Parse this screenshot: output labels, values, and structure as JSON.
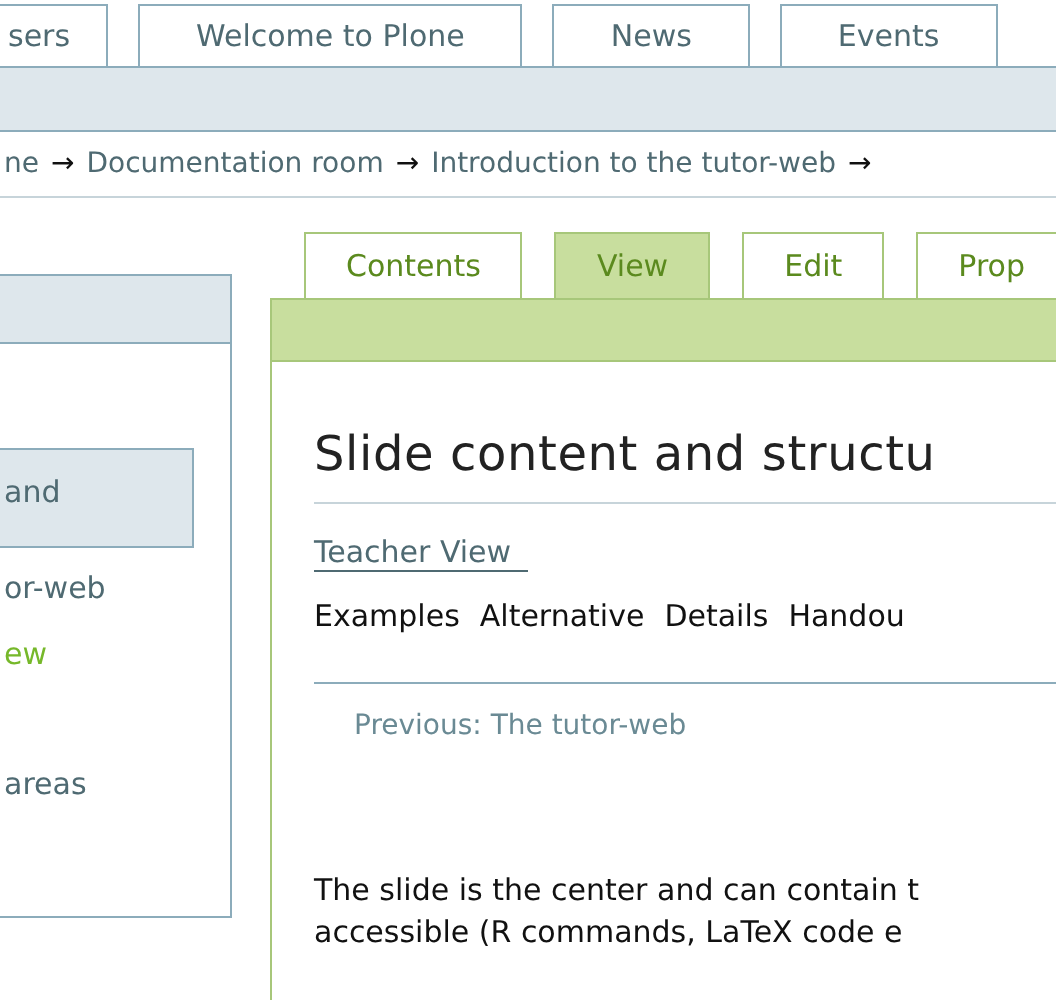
{
  "top_tabs": [
    {
      "label": "sers",
      "selected": false
    },
    {
      "label": "Welcome to Plone",
      "selected": false
    },
    {
      "label": "News",
      "selected": false
    },
    {
      "label": "Events",
      "selected": false
    }
  ],
  "breadcrumbs": [
    "ne",
    "Documentation room",
    "Introduction to the tutor-web"
  ],
  "breadcrumb_separator": "→",
  "sidebar": {
    "items": [
      {
        "label": "and",
        "selected": true,
        "current": false
      },
      {
        "label": "or-web",
        "selected": false,
        "current": false
      },
      {
        "label": "ew",
        "selected": false,
        "current": true
      },
      {
        "label": "areas",
        "selected": false,
        "current": false
      }
    ]
  },
  "content_tabs": [
    {
      "label": "Contents",
      "selected": false
    },
    {
      "label": "View",
      "selected": true
    },
    {
      "label": "Edit",
      "selected": false
    },
    {
      "label": "Prop",
      "selected": false
    }
  ],
  "heading": "Slide content and structu",
  "teacher_view_link": "Teacher View",
  "slide_links": [
    "Examples",
    "Alternative",
    "Details",
    "Handou"
  ],
  "previous_link": "Previous: The tutor-web",
  "body_lines": [
    "The slide is the center and can contain t",
    "accessible (R commands, LaTeX code e"
  ]
}
